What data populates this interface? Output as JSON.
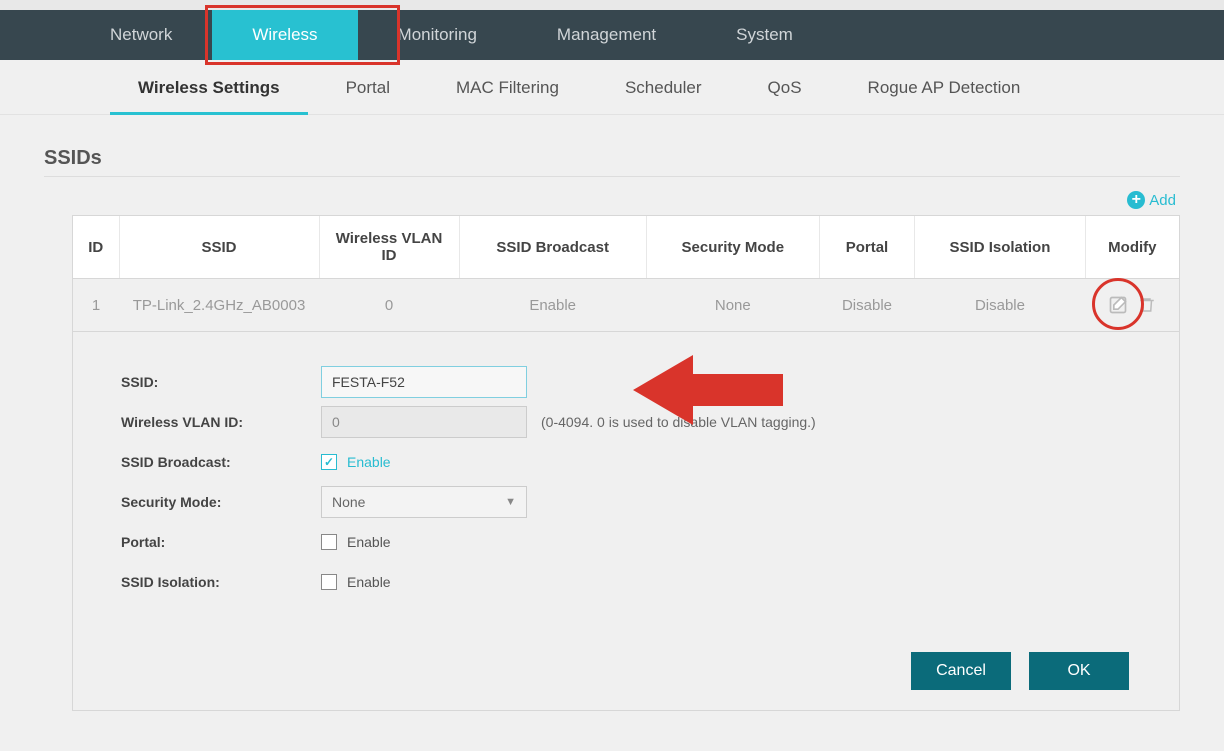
{
  "mainNav": {
    "network": "Network",
    "wireless": "Wireless",
    "monitoring": "Monitoring",
    "management": "Management",
    "system": "System"
  },
  "subNav": {
    "wirelessSettings": "Wireless Settings",
    "portal": "Portal",
    "macFiltering": "MAC Filtering",
    "scheduler": "Scheduler",
    "qos": "QoS",
    "rogueAp": "Rogue AP Detection"
  },
  "section": {
    "title": "SSIDs",
    "addLabel": "Add"
  },
  "table": {
    "headers": {
      "id": "ID",
      "ssid": "SSID",
      "vlan": "Wireless VLAN ID",
      "broadcast": "SSID Broadcast",
      "security": "Security Mode",
      "portal": "Portal",
      "isolation": "SSID Isolation",
      "modify": "Modify"
    },
    "row": {
      "id": "1",
      "ssid": "TP-Link_2.4GHz_AB0003",
      "vlan": "0",
      "broadcast": "Enable",
      "security": "None",
      "portal": "Disable",
      "isolation": "Disable"
    }
  },
  "form": {
    "labels": {
      "ssid": "SSID:",
      "vlan": "Wireless VLAN ID:",
      "broadcast": "SSID Broadcast:",
      "security": "Security Mode:",
      "portal": "Portal:",
      "isolation": "SSID Isolation:"
    },
    "values": {
      "ssid": "FESTA-F52",
      "vlan": "0",
      "vlanHint": "(0-4094. 0 is used to disable VLAN tagging.)",
      "enable": "Enable",
      "securityMode": "None"
    },
    "buttons": {
      "cancel": "Cancel",
      "ok": "OK"
    }
  }
}
